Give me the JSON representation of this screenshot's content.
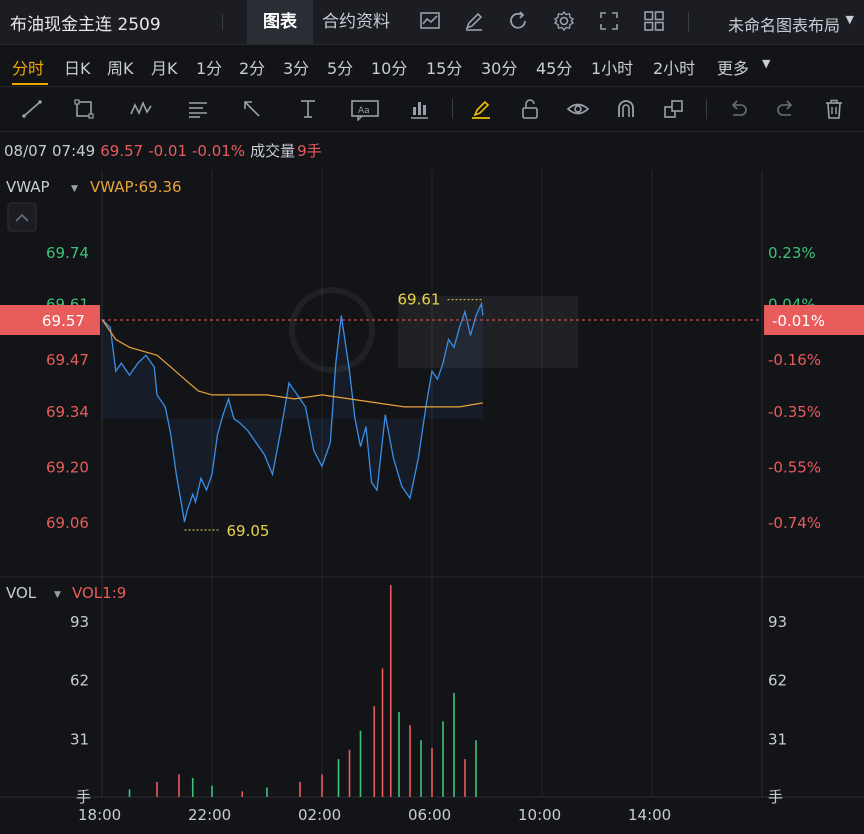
{
  "header": {
    "title": "布油现金主连 2509",
    "tabs": [
      "图表",
      "合约资料"
    ],
    "layout_label": "未命名图表布局"
  },
  "periods": [
    "分时",
    "日K",
    "周K",
    "月K",
    "1分",
    "2分",
    "3分",
    "5分",
    "10分",
    "15分",
    "30分",
    "45分",
    "1小时",
    "2小时",
    "更多"
  ],
  "active_period": "分时",
  "info": {
    "datetime": "08/07 07:49",
    "price": "69.57",
    "change": "-0.01",
    "change_pct": "-0.01%",
    "volume_label": "成交量",
    "volume_value": "9手"
  },
  "price_panel": {
    "indicator": "VWAP",
    "indicator_value": "VWAP:69.36",
    "left_ticks": [
      "69.74",
      "69.61",
      "69.47",
      "69.34",
      "69.20",
      "69.06"
    ],
    "right_ticks": [
      "0.23%",
      "0.04%",
      "-0.16%",
      "-0.35%",
      "-0.55%",
      "-0.74%"
    ],
    "current_price": "69.57",
    "current_pct": "-0.01%",
    "high_label": "69.61",
    "low_label": "69.05"
  },
  "volume_panel": {
    "indicator": "VOL",
    "indicator_value": "VOL1:9",
    "ticks": [
      "93",
      "62",
      "31"
    ],
    "unit": "手"
  },
  "x_ticks": [
    "18:00",
    "22:00",
    "02:00",
    "06:00",
    "10:00",
    "14:00"
  ],
  "colors": {
    "up": "#e85c5c",
    "down": "#3cc378",
    "accent": "#f0a500",
    "line": "#3a8ee6",
    "vwap": "#e8a33a"
  },
  "chart_data": {
    "type": "line",
    "x_unit": "hours since 18:00",
    "price_series": {
      "x": [
        0,
        0.3,
        0.5,
        0.7,
        1.0,
        1.3,
        1.6,
        1.9,
        2.0,
        2.3,
        2.5,
        2.7,
        2.9,
        3.0,
        3.1,
        3.3,
        3.4,
        3.6,
        3.8,
        4.0,
        4.2,
        4.4,
        4.6,
        4.8,
        5.0,
        5.3,
        5.6,
        5.9,
        6.2,
        6.5,
        6.8,
        7.1,
        7.4,
        7.7,
        8.0,
        8.3,
        8.5,
        8.7,
        9.0,
        9.2,
        9.4,
        9.6,
        9.8,
        10.0,
        10.3,
        10.6,
        10.9,
        11.2,
        11.5,
        11.8,
        12.0,
        12.2,
        12.4,
        12.6,
        12.8,
        13.0,
        13.2,
        13.4,
        13.6,
        13.8,
        13.85
      ],
      "y": [
        69.57,
        69.55,
        69.44,
        69.46,
        69.43,
        69.46,
        69.48,
        69.45,
        69.38,
        69.35,
        69.28,
        69.18,
        69.1,
        69.06,
        69.09,
        69.13,
        69.11,
        69.17,
        69.14,
        69.18,
        69.28,
        69.33,
        69.37,
        69.32,
        69.31,
        69.29,
        69.26,
        69.23,
        69.18,
        69.29,
        69.41,
        69.38,
        69.35,
        69.24,
        69.2,
        69.26,
        69.46,
        69.58,
        69.44,
        69.32,
        69.25,
        69.3,
        69.16,
        69.14,
        69.33,
        69.22,
        69.15,
        69.12,
        69.22,
        69.36,
        69.44,
        69.42,
        69.46,
        69.52,
        69.5,
        69.55,
        69.59,
        69.53,
        69.58,
        69.61,
        69.58
      ]
    },
    "vwap_series": {
      "x": [
        0,
        0.5,
        1.0,
        1.5,
        2.0,
        2.5,
        3.0,
        3.5,
        4.0,
        5.0,
        6.0,
        7.0,
        8.0,
        9.0,
        10.0,
        11.0,
        12.0,
        13.0,
        13.85
      ],
      "y": [
        69.57,
        69.52,
        69.5,
        69.49,
        69.48,
        69.45,
        69.42,
        69.39,
        69.38,
        69.38,
        69.38,
        69.37,
        69.38,
        69.37,
        69.36,
        69.35,
        69.35,
        69.35,
        69.36
      ]
    },
    "volume_series": {
      "x": [
        1,
        2,
        2.8,
        3.3,
        4.0,
        5.1,
        6.0,
        7.2,
        8.0,
        8.6,
        9.0,
        9.4,
        9.9,
        10.2,
        10.5,
        10.8,
        11.2,
        11.6,
        12.0,
        12.4,
        12.8,
        13.2,
        13.6
      ],
      "values": [
        4,
        8,
        12,
        10,
        6,
        3,
        5,
        8,
        12,
        20,
        25,
        35,
        48,
        68,
        112,
        45,
        38,
        30,
        26,
        40,
        55,
        20,
        30
      ],
      "colors": [
        "down",
        "up",
        "up",
        "down",
        "down",
        "up",
        "down",
        "up",
        "up",
        "down",
        "up",
        "down",
        "up",
        "up",
        "up",
        "down",
        "up",
        "down",
        "up",
        "down",
        "down",
        "up",
        "down"
      ]
    },
    "ylim": [
      69.0,
      69.8
    ],
    "volume_ylim": [
      0,
      120
    ],
    "xlim": [
      0,
      24
    ]
  }
}
